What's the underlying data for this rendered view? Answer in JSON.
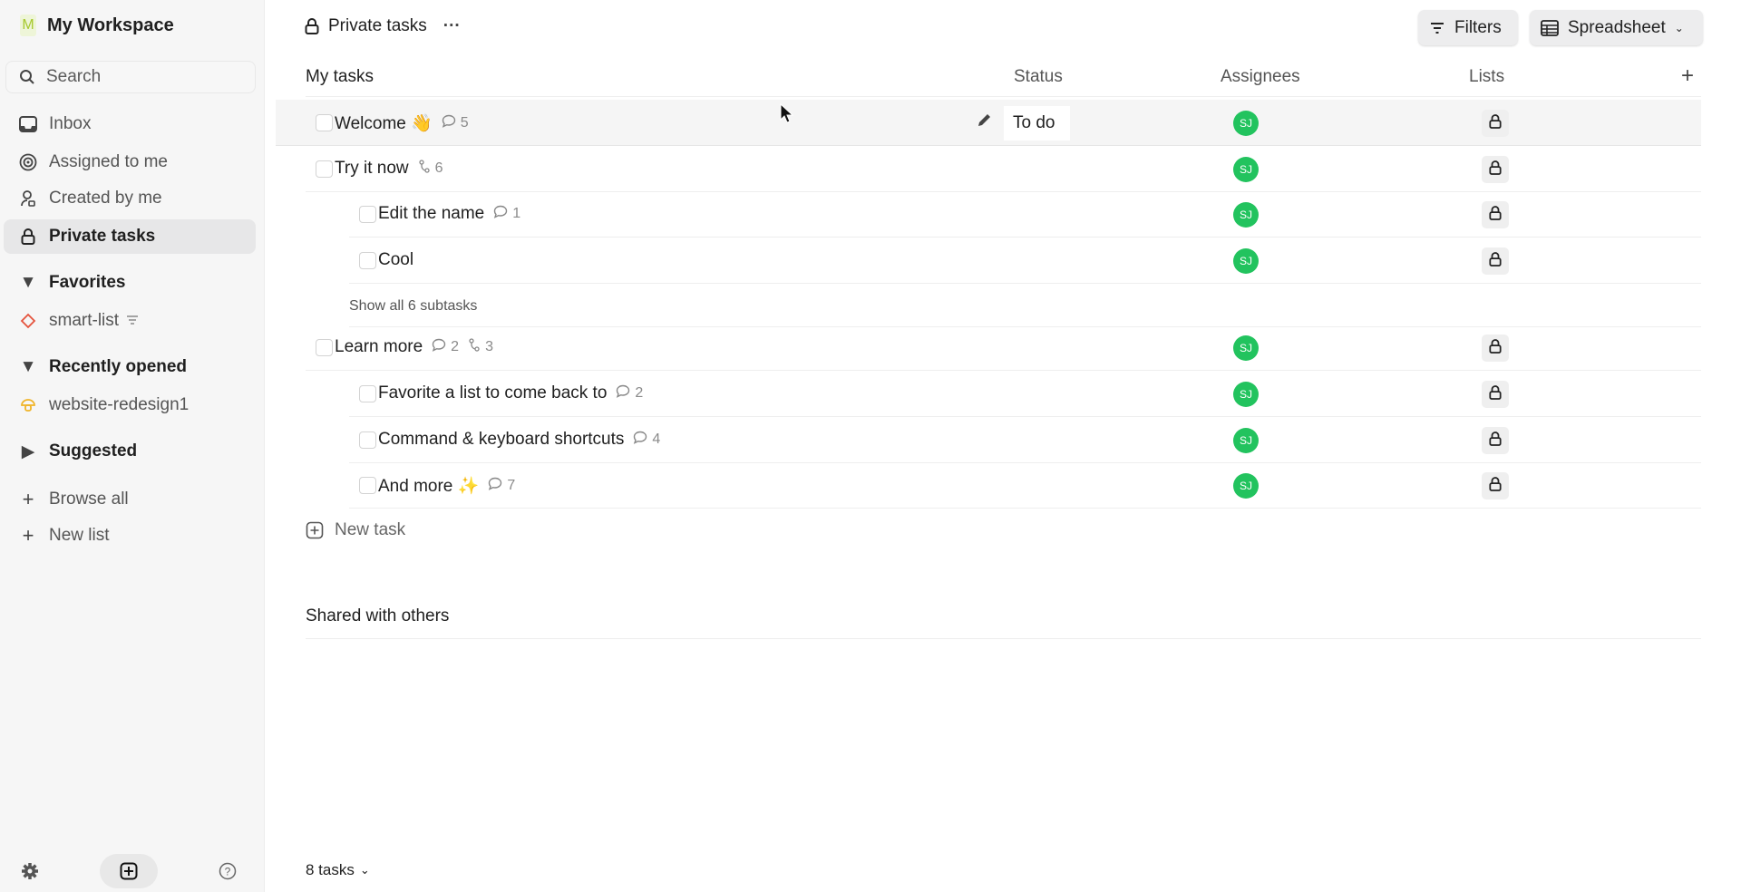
{
  "sidebar": {
    "workspace_initial": "M",
    "workspace_name": "My Workspace",
    "search_placeholder": "Search",
    "nav": [
      {
        "label": "Inbox",
        "icon": "inbox-icon"
      },
      {
        "label": "Assigned to me",
        "icon": "target-icon"
      },
      {
        "label": "Created by me",
        "icon": "user-icon"
      },
      {
        "label": "Private tasks",
        "icon": "lock-icon",
        "selected": true
      }
    ],
    "favorites": {
      "title": "Favorites",
      "items": [
        {
          "label": "smart-list",
          "icon": "diamond-icon",
          "color": "#e5533d"
        }
      ]
    },
    "recent": {
      "title": "Recently opened",
      "items": [
        {
          "label": "website-redesign1",
          "icon": "mushroom-icon",
          "color": "#f0b429"
        }
      ]
    },
    "suggested": {
      "title": "Suggested"
    },
    "browse_all": "Browse all",
    "new_list": "New list"
  },
  "header": {
    "title": "Private tasks",
    "more": "···",
    "filters": "Filters",
    "view": "Spreadsheet"
  },
  "columns": {
    "name": "My tasks",
    "status": "Status",
    "assignees": "Assignees",
    "lists": "Lists",
    "add": "+"
  },
  "tasks": [
    {
      "name": "Welcome 👋",
      "comments": "5",
      "status": "To do",
      "assignee": "SJ"
    },
    {
      "name": "Try it now",
      "subtasks": "6",
      "assignee": "SJ"
    },
    {
      "name": "Edit the name",
      "comments": "1",
      "assignee": "SJ"
    },
    {
      "name": "Cool",
      "assignee": "SJ"
    },
    {
      "show_all": "Show all 6 subtasks"
    },
    {
      "name": "Learn more",
      "comments": "2",
      "subtasks": "3",
      "assignee": "SJ"
    },
    {
      "name": "Favorite a list to come back to",
      "comments": "2",
      "assignee": "SJ"
    },
    {
      "name": "Command & keyboard shortcuts",
      "comments": "4",
      "assignee": "SJ"
    },
    {
      "name": "And more ✨",
      "comments": "7",
      "assignee": "SJ"
    }
  ],
  "new_task": "New task",
  "shared_section": "Shared with others",
  "footer": {
    "count": "8 tasks"
  },
  "colors": {
    "accent_avatar": "#22c35e",
    "sidebar_bg": "#f6f6f6"
  }
}
